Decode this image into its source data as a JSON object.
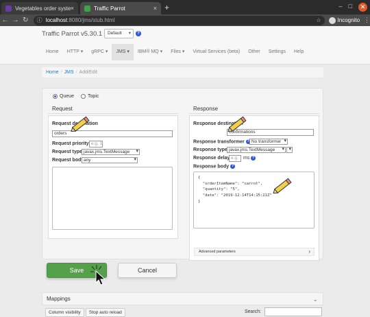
{
  "browser": {
    "tabs": [
      {
        "title": "Vegetables order system",
        "close": "×"
      },
      {
        "title": "Traffic Parrot",
        "close": "×"
      }
    ],
    "new_tab": "+",
    "window_controls": {
      "minimize": "–",
      "maximize": "□",
      "close": "✕"
    },
    "nav": {
      "back": "←",
      "forward": "→",
      "reload": "↻"
    },
    "url_host": "localhost",
    "url_path": ":8080/jms/stub.html",
    "bookmark_star": "☆",
    "incognito_label": "Incognito",
    "menu": "⋮"
  },
  "header": {
    "brand": "Traffic Parrot v5.30.1",
    "version_select": "Default",
    "help": "?"
  },
  "nav": {
    "items": [
      "Home",
      "HTTP ▾",
      "gRPC ▾",
      "JMS ▾",
      "IBM® MQ ▾",
      "Files ▾",
      "Virtual Services (beta)",
      "Other",
      "Settings",
      "Help"
    ],
    "active": "JMS ▾"
  },
  "breadcrumb": {
    "home": "Home",
    "jms": "JMS",
    "current": "Add/Edit",
    "sep": "/"
  },
  "destination_type": {
    "queue": "Queue",
    "topic": "Topic",
    "selected": "Queue"
  },
  "request": {
    "heading": "Request",
    "destination_label": "Request destination",
    "destination_value": "orders",
    "priority_label": "Request priority",
    "priority_placeholder": "e.g. 1",
    "type_label": "Request type",
    "type_value": "javax.jms.TextMessage",
    "body_label": "Request body",
    "body_value": "any"
  },
  "response": {
    "heading": "Response",
    "destination_label": "Response destination",
    "destination_value": "confirmations",
    "transformer_label": "Response transformer",
    "transformer_value": "No transformer",
    "type_label": "Response type",
    "type_value": "javax.jms.TextMessage",
    "delay_label": "Response delay",
    "delay_placeholder": "e.g.",
    "delay_unit": "ms",
    "body_label": "Response body",
    "body_lines": [
      "{",
      "  \"orderItemName\": \"carrot\",",
      "  \"quantity\": \"5\",",
      "  \"date\": \"2019-12-14T14:15:21Z\"",
      "}"
    ],
    "advanced": "Advanced parameters"
  },
  "actions": {
    "save": "Save",
    "cancel": "Cancel"
  },
  "mappings": {
    "heading": "Mappings",
    "column_visibility": "Column visibility",
    "stop_auto_reload": "Stop auto reload",
    "search_label": "Search:"
  },
  "colors": {
    "save_green": "#55a14b",
    "link_blue": "#337ab7",
    "pencil_yellow": "#f2d04b",
    "close_orange": "#e05a2b"
  }
}
